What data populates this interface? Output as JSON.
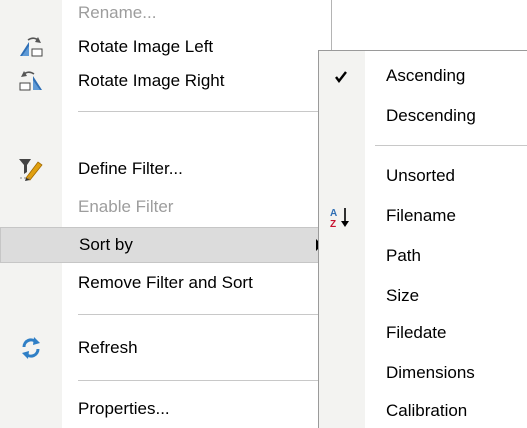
{
  "menu": {
    "items": [
      {
        "label": "Rename...",
        "enabled": false
      },
      {
        "label": "Rotate Image Left",
        "icon": "rotate-left-icon"
      },
      {
        "label": "Rotate Image Right",
        "icon": "rotate-right-icon"
      },
      {
        "label": "Define Filter...",
        "icon": "filter-icon"
      },
      {
        "label": "Enable Filter",
        "enabled": false
      },
      {
        "label": "Sort by",
        "highlighted": true,
        "has_submenu": true
      },
      {
        "label": "Remove Filter and Sort"
      },
      {
        "label": "Refresh",
        "icon": "refresh-icon"
      },
      {
        "label": "Properties..."
      }
    ]
  },
  "submenu": {
    "items": [
      {
        "label": "Ascending",
        "checked": true
      },
      {
        "label": "Descending"
      },
      {
        "label": "Unsorted"
      },
      {
        "label": "Filename",
        "icon": "sort-az-icon"
      },
      {
        "label": "Path"
      },
      {
        "label": "Size"
      },
      {
        "label": "Filedate"
      },
      {
        "label": "Dimensions"
      },
      {
        "label": "Calibration"
      }
    ]
  },
  "colors": {
    "gutter": "#f3f3f1",
    "highlight": "#dcdcdc",
    "disabled_text": "#9d9d9d",
    "icon_blue": "#2f7fc6",
    "icon_red": "#c8102e"
  }
}
